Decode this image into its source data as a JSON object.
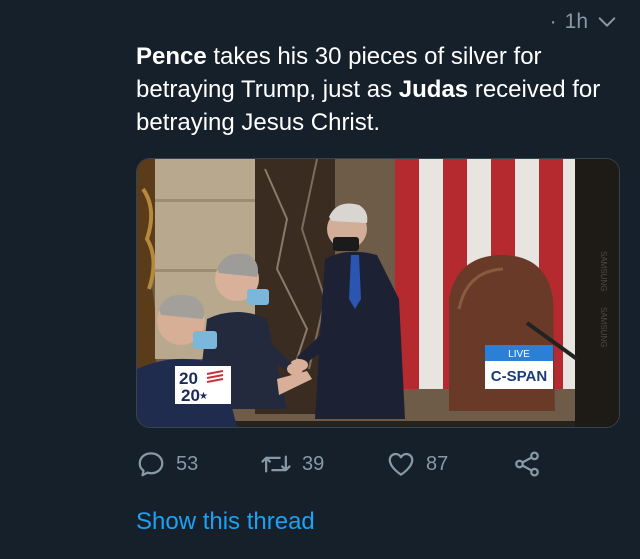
{
  "header": {
    "dot": "·",
    "time": "1h"
  },
  "tweet": {
    "segments": [
      {
        "text": "Pence",
        "bold": true
      },
      {
        "text": " takes his 30 pieces of silver for betraying Trump, just as ",
        "bold": false
      },
      {
        "text": "Judas",
        "bold": true
      },
      {
        "text": " received for betraying Jesus Christ.",
        "bold": false
      }
    ]
  },
  "media": {
    "live_label": "LIVE",
    "network_label": "C-SPAN",
    "year_top": "20",
    "year_bottom": "20",
    "samsung_top": "SAMSUNG",
    "samsung_bottom": "SAMSUNG"
  },
  "actions": {
    "reply_count": "53",
    "retweet_count": "39",
    "like_count": "87"
  },
  "show_thread": "Show this thread",
  "icons": [
    "chevron-down-icon",
    "reply-icon",
    "retweet-icon",
    "heart-icon",
    "share-icon"
  ],
  "colors": {
    "background": "#15202b",
    "text": "#ffffff",
    "muted": "#8899a6",
    "link": "#1da1f2"
  }
}
